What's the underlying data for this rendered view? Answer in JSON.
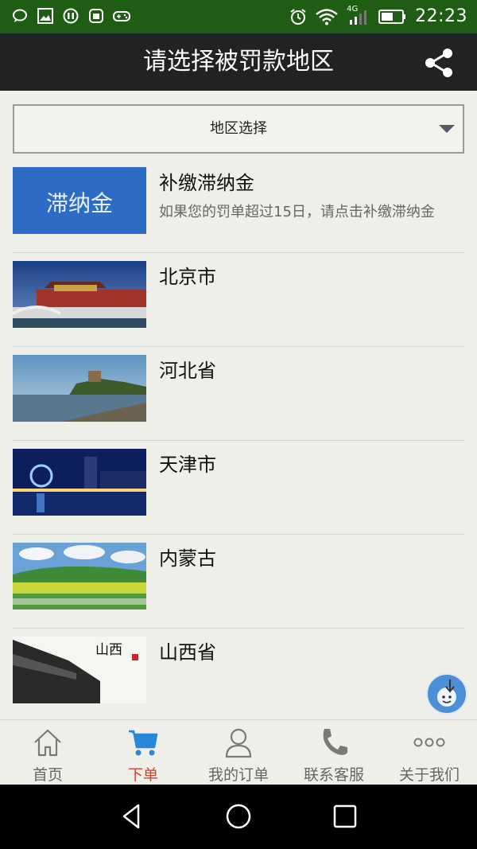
{
  "status_bar": {
    "time": "22:23",
    "network_label": "4G",
    "icons": [
      "chat-bubble-icon",
      "image-icon",
      "app-icon",
      "android-icon",
      "gamepad-icon",
      "alarm-icon",
      "wifi-icon",
      "signal-icon",
      "battery-icon"
    ]
  },
  "header": {
    "title": "请选择被罚款地区",
    "share_icon": "share-icon"
  },
  "selector": {
    "label": "地区选择",
    "caret_icon": "chevron-down-icon"
  },
  "banner_text": "滞纳金",
  "regions": [
    {
      "title": "补缴滞纳金",
      "subtitle": "如果您的罚单超过15日，请点击补缴滞纳金"
    },
    {
      "title": "北京市",
      "subtitle": ""
    },
    {
      "title": "河北省",
      "subtitle": ""
    },
    {
      "title": "天津市",
      "subtitle": ""
    },
    {
      "title": "内蒙古",
      "subtitle": ""
    },
    {
      "title": "山西省",
      "subtitle": ""
    }
  ],
  "shanxi_caption": "山西",
  "tabs": [
    {
      "label": "首页",
      "icon": "home-icon",
      "active": false
    },
    {
      "label": "下单",
      "icon": "cart-icon",
      "active": true
    },
    {
      "label": "我的订单",
      "icon": "user-icon",
      "active": false
    },
    {
      "label": "联系客服",
      "icon": "phone-icon",
      "active": false
    },
    {
      "label": "关于我们",
      "icon": "more-icon",
      "active": false
    }
  ],
  "colors": {
    "status_bar": "#1f5d14",
    "header": "#202223",
    "active_tab": "#d8402c",
    "banner": "#2c6cc4"
  }
}
